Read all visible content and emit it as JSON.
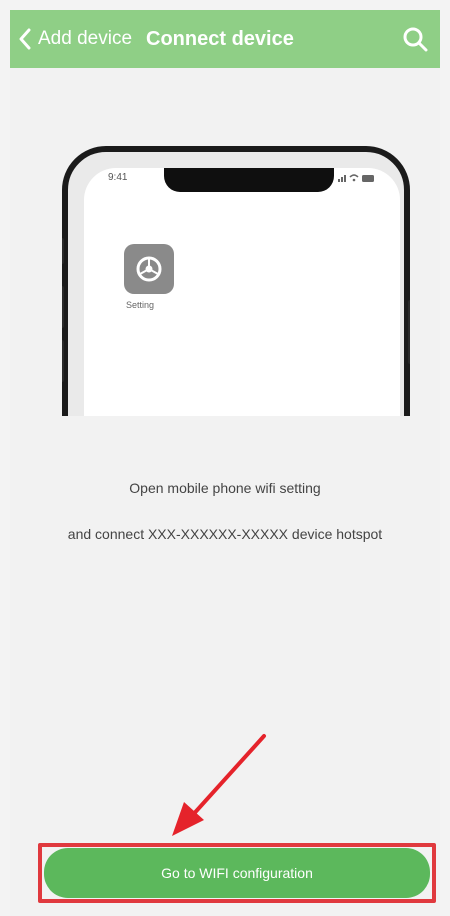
{
  "header": {
    "back_label": "Add device",
    "title": "Connect device"
  },
  "icons": {
    "back": "chevron-left-icon",
    "search": "search-icon",
    "settings": "gear-icon"
  },
  "phone_mock": {
    "time": "9:41",
    "app_label": "Setting"
  },
  "instructions": {
    "line1": "Open mobile phone wifi setting",
    "line2": "and connect XXX-XXXXXX-XXXXX device hotspot"
  },
  "cta": {
    "label": "Go to WIFI configuration"
  },
  "colors": {
    "header_bg": "#8fcf86",
    "cta_bg": "#5cb85c",
    "highlight": "#e0393e"
  }
}
